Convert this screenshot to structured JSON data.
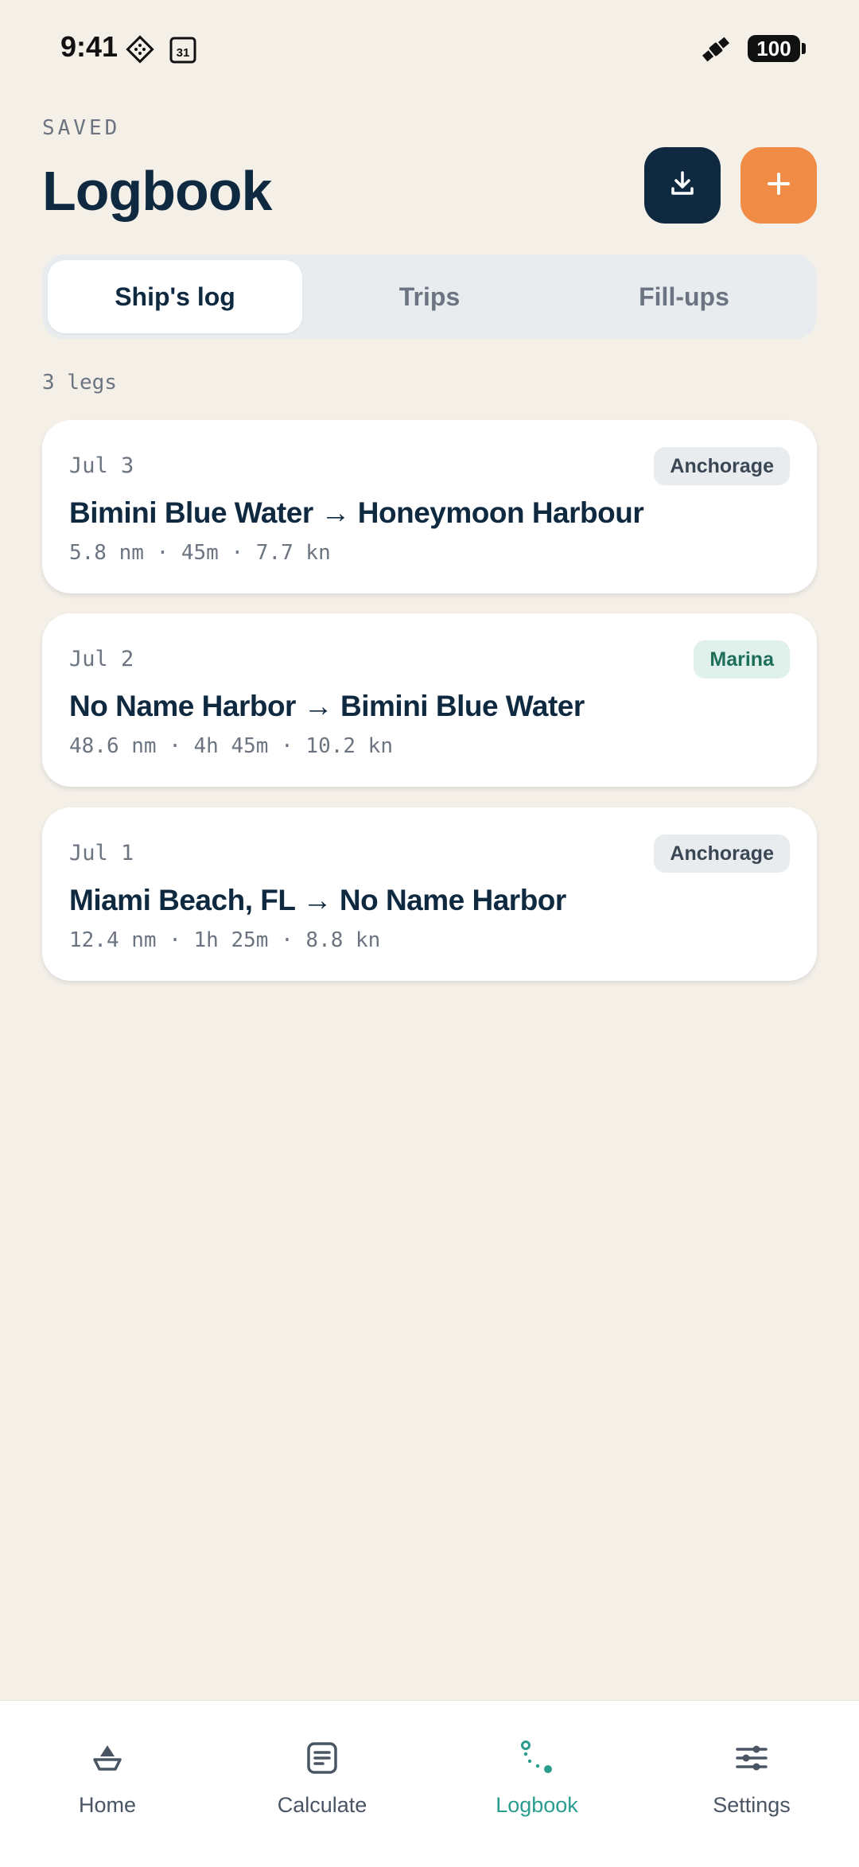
{
  "status_bar": {
    "time": "9:41",
    "battery": "100",
    "icons": [
      "navigation-diamond-icon",
      "calendar-icon",
      "satellite-icon",
      "battery-icon"
    ],
    "calendar_day": "31"
  },
  "header": {
    "overline": "SAVED",
    "title": "Logbook",
    "actions": [
      {
        "icon": "download-icon"
      },
      {
        "icon": "plus-icon"
      }
    ]
  },
  "tabs": [
    {
      "label": "Ship's log",
      "active": true
    },
    {
      "label": "Trips",
      "active": false
    },
    {
      "label": "Fill-ups",
      "active": false
    }
  ],
  "legs_count": "3 legs",
  "legs": [
    {
      "date": "Jul 3",
      "badge": "Anchorage",
      "route": "Bimini Blue Water → Honeymoon Harbour",
      "stats": "5.8 nm · 45m · 7.7 kn"
    },
    {
      "date": "Jul 2",
      "badge": "Marina",
      "route": "No Name Harbor → Bimini Blue Water",
      "stats": "48.6 nm · 4h 45m · 10.2 kn"
    },
    {
      "date": "Jul 1",
      "badge": "Anchorage",
      "route": "Miami Beach, FL → No Name Harbor",
      "stats": "12.4 nm · 1h 25m · 8.8 kn"
    }
  ],
  "bottom_nav": [
    {
      "label": "Home",
      "icon": "boat-icon"
    },
    {
      "label": "Calculate",
      "icon": "calculator-icon"
    },
    {
      "label": "Logbook",
      "icon": "route-icon",
      "active": true
    },
    {
      "label": "Settings",
      "icon": "sliders-icon"
    }
  ],
  "colors": {
    "background": "#F4EFE7",
    "navy": "#0F2A40",
    "orange": "#F08C45",
    "teal": "#2A9D8F"
  }
}
